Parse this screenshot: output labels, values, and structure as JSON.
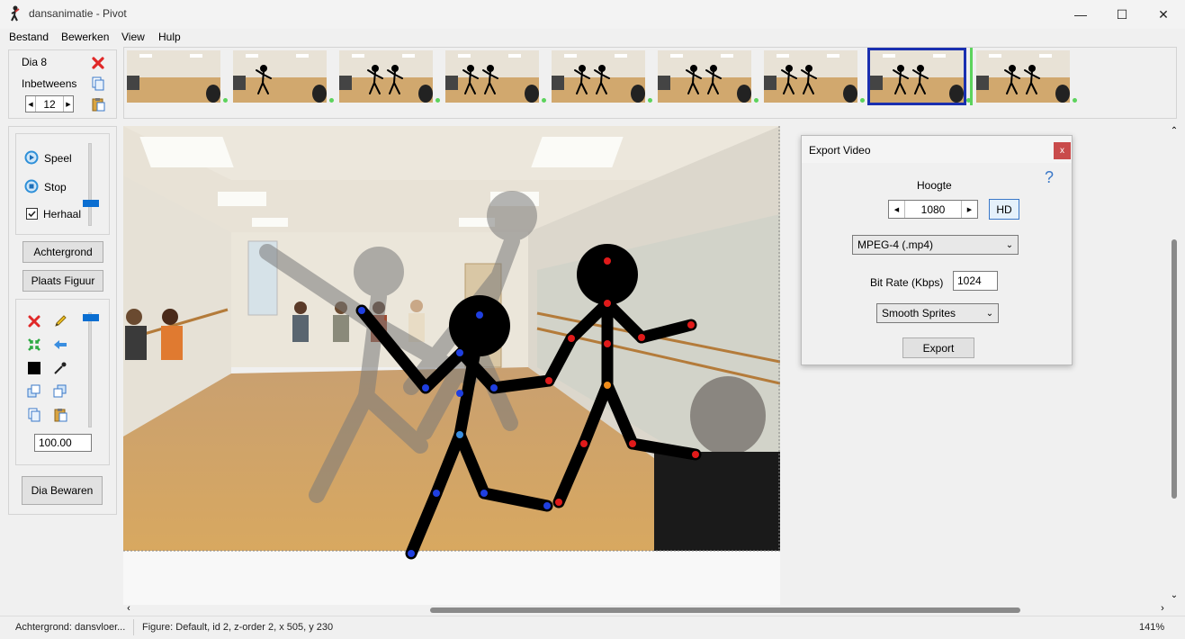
{
  "window": {
    "title": "dansanimatie - Pivot",
    "minimize": "—",
    "maximize": "☐",
    "close": "✕"
  },
  "menu": [
    "Bestand",
    "Bewerken",
    "View",
    "Hulp"
  ],
  "slide_panel": {
    "slide_label": "Dia 8",
    "inbetweens_label": "Inbetweens",
    "inbetweens_value": "12"
  },
  "playback": {
    "play_label": "Speel",
    "stop_label": "Stop",
    "repeat_label": "Herhaal",
    "repeat_checked": true
  },
  "buttons": {
    "background": "Achtergrond",
    "place_figure": "Plaats Figuur",
    "save_slide": "Dia Bewaren"
  },
  "figure_tools": {
    "scale_value": "100.00"
  },
  "thumbnails": {
    "count": 9,
    "selected_index": 7
  },
  "export_dialog": {
    "title": "Export Video",
    "close_label": "x",
    "help_label": "?",
    "height_label": "Hoogte",
    "height_value": "1080",
    "hd_label": "HD",
    "format_value": "MPEG-4 (.mp4)",
    "bitrate_label": "Bit Rate (Kbps)",
    "bitrate_value": "1024",
    "smoothing_value": "Smooth Sprites",
    "export_button": "Export"
  },
  "statusbar": {
    "background": "Achtergrond: dansvloer...",
    "figure": "Figure: Default,  id 2,  z-order 2,  x 505, y 230",
    "zoom": "141%"
  },
  "colors": {
    "selected_border": "#1a2fb0",
    "joint_blue": "#1f3fe0",
    "joint_red": "#e01a1a",
    "joint_orange": "#f08c1a",
    "frame_dot": "#5cd35c",
    "play_icon": "#2d8fd8"
  }
}
